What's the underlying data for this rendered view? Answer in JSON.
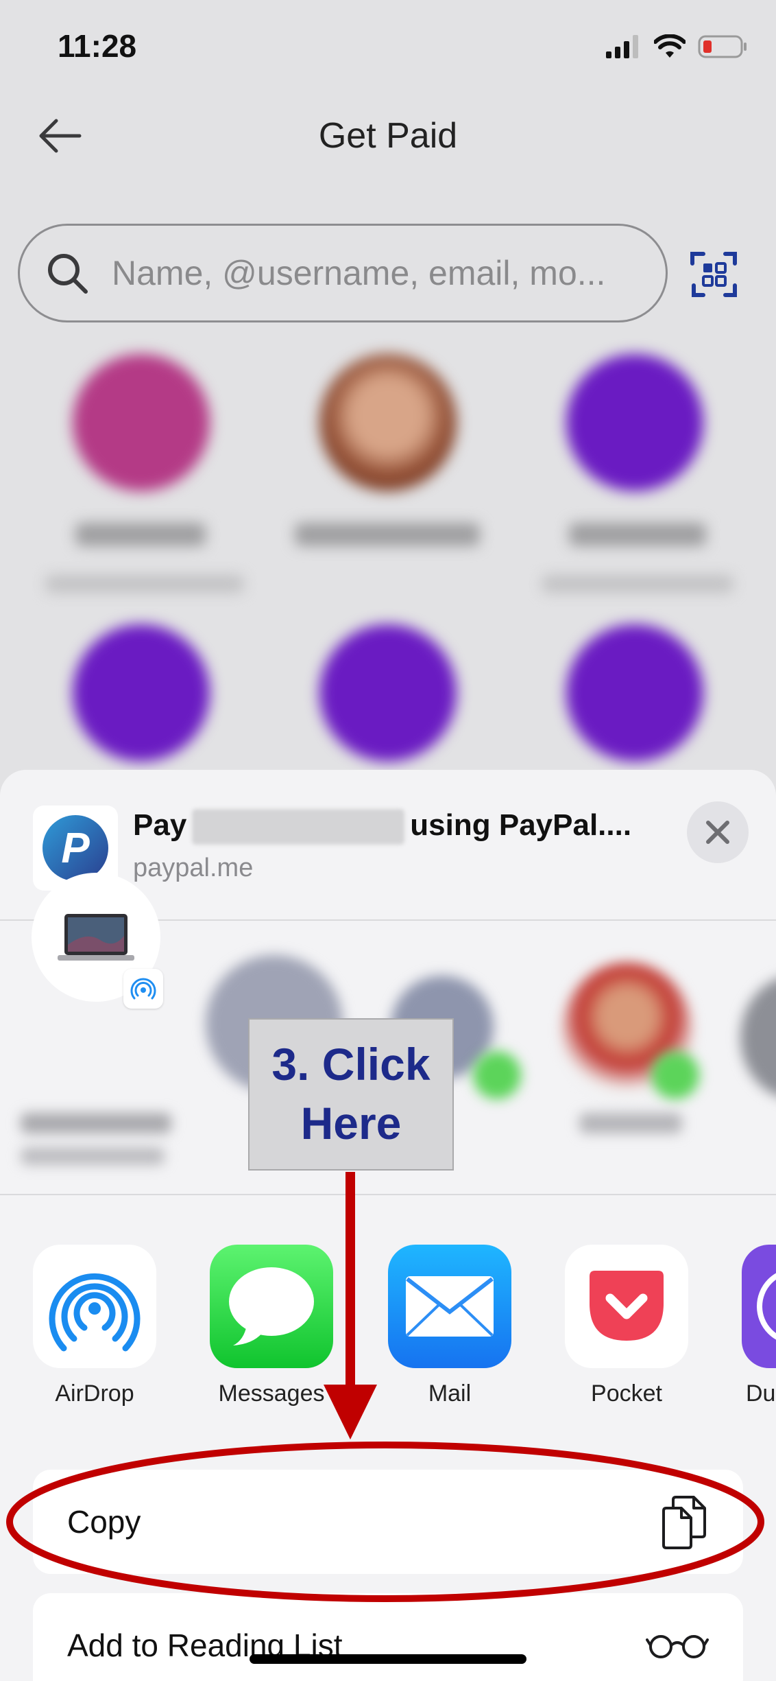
{
  "status_bar": {
    "time": "11:28"
  },
  "header": {
    "title": "Get Paid"
  },
  "search": {
    "placeholder": "Name, @username, email, mo..."
  },
  "share_sheet": {
    "link": {
      "title_prefix": "Pay",
      "title_suffix": "using PayPal....",
      "domain": "paypal.me"
    },
    "apps": [
      {
        "label": "AirDrop",
        "icon": "airdrop-icon"
      },
      {
        "label": "Messages",
        "icon": "messages-icon"
      },
      {
        "label": "Mail",
        "icon": "mail-icon"
      },
      {
        "label": "Pocket",
        "icon": "pocket-icon"
      },
      {
        "label": "Duc",
        "icon": "duckduckgo-icon"
      }
    ],
    "actions": [
      {
        "label": "Copy",
        "icon": "copy-icon"
      },
      {
        "label": "Add to Reading List",
        "icon": "glasses-icon"
      }
    ]
  },
  "annotation": {
    "text": "3. Click\nHere"
  },
  "colors": {
    "annotation_red": "#c00000",
    "annotation_text": "#1d2a8a",
    "search_icon_blue": "#1e3a9a"
  }
}
